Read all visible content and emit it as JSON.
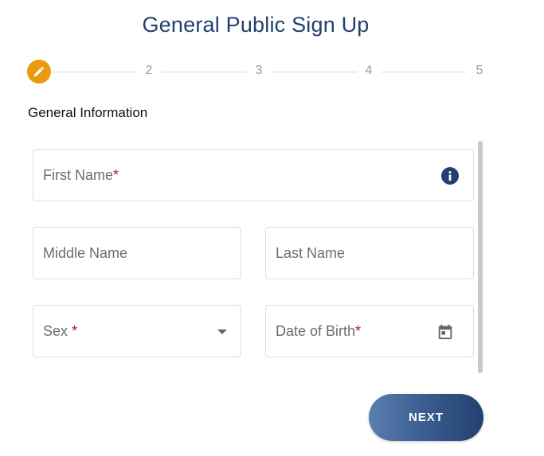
{
  "title": "General Public Sign Up",
  "stepper": {
    "current_icon": "pencil-icon",
    "steps": [
      "2",
      "3",
      "4",
      "5"
    ]
  },
  "section_title": "General Information",
  "fields": {
    "first_name": {
      "label": "First Name",
      "required": "*",
      "icon": "info-icon"
    },
    "middle_name": {
      "label": "Middle Name"
    },
    "last_name": {
      "label": "Last Name"
    },
    "sex": {
      "label": "Sex ",
      "required": "*",
      "icon": "chevron-down-icon"
    },
    "date_of_birth": {
      "label": "Date of Birth",
      "required": "*",
      "icon": "calendar-icon"
    }
  },
  "next_button": {
    "label": "NEXT"
  },
  "colors": {
    "primary": "#22416f",
    "step_active": "#e89b0c",
    "required": "#b01f1f"
  }
}
